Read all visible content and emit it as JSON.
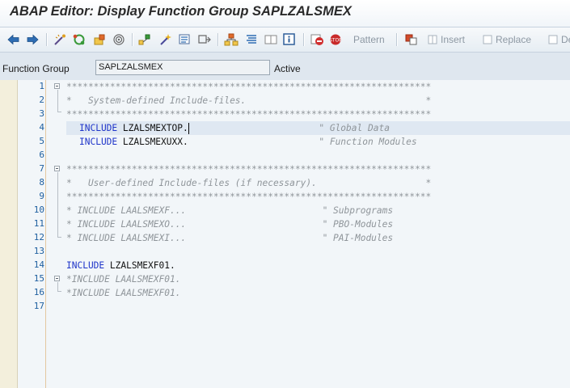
{
  "window": {
    "title": "ABAP Editor: Display Function Group SAPLZALSMEX"
  },
  "toolbar": {
    "icons": [
      "back-arrow-icon",
      "forward-arrow-icon",
      "other-object-icon",
      "display-change-icon",
      "active-inactive-icon",
      "where-used-icon",
      "hierarchy-icon",
      "wizard-icon",
      "display-object-list-icon",
      "navigation-window-icon",
      "enhance-icon",
      "pretty-printer-icon",
      "split-screen-icon",
      "help-on-icon",
      "stop-icon",
      "breakpoint-icon"
    ],
    "pattern_label": "Pattern",
    "insert_label": "Insert",
    "replace_label": "Replace",
    "delete_label": "De"
  },
  "header": {
    "field_label": "Function Group",
    "field_value": "SAPLZALSMEX",
    "status": "Active"
  },
  "editor": {
    "line_numbers": [
      "1",
      "2",
      "3",
      "4",
      "5",
      "6",
      "7",
      "8",
      "9",
      "10",
      "11",
      "12",
      "13",
      "14",
      "15",
      "16",
      "17"
    ],
    "lines": {
      "l1": "*******************************************************************",
      "l2": "*   System-defined Include-files.                                 *",
      "l3": "*******************************************************************",
      "l4_kw": "INCLUDE",
      "l4_id": " LZALSMEXTOP.",
      "l4_cm": "                        \" Global Data",
      "l5_kw": "INCLUDE",
      "l5_id": " LZALSMEXUXX.",
      "l5_cm": "                        \" Function Modules",
      "l7": "*******************************************************************",
      "l8": "*   User-defined Include-files (if necessary).                    *",
      "l9": "*******************************************************************",
      "l10": "* INCLUDE LAALSMEXF...                         \" Subprograms",
      "l11": "* INCLUDE LAALSMEXO...                         \" PBO-Modules",
      "l12": "* INCLUDE LAALSMEXI...                         \" PAI-Modules",
      "l14_kw": "INCLUDE",
      "l14_id": " LZALSMEXF01.",
      "l15": "*INCLUDE LAALSMEXF01.",
      "l16": "*INCLUDE LAALSMEXF01."
    }
  }
}
